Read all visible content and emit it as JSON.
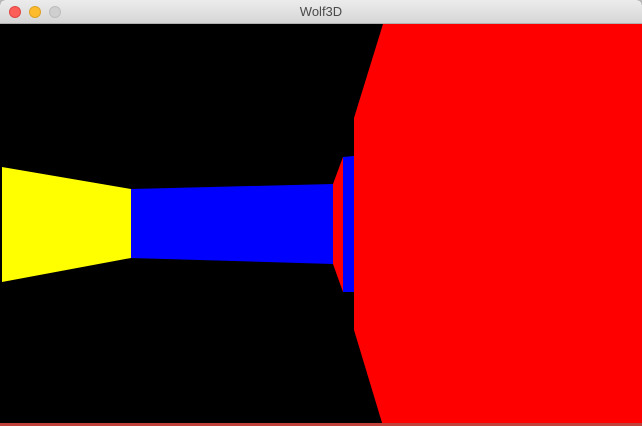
{
  "window": {
    "title": "Wolf3D"
  },
  "scene": {
    "background_color": "#000000",
    "wall_colors": {
      "yellow": "#ffff00",
      "blue": "#0000ff",
      "red": "#ff0000"
    }
  }
}
